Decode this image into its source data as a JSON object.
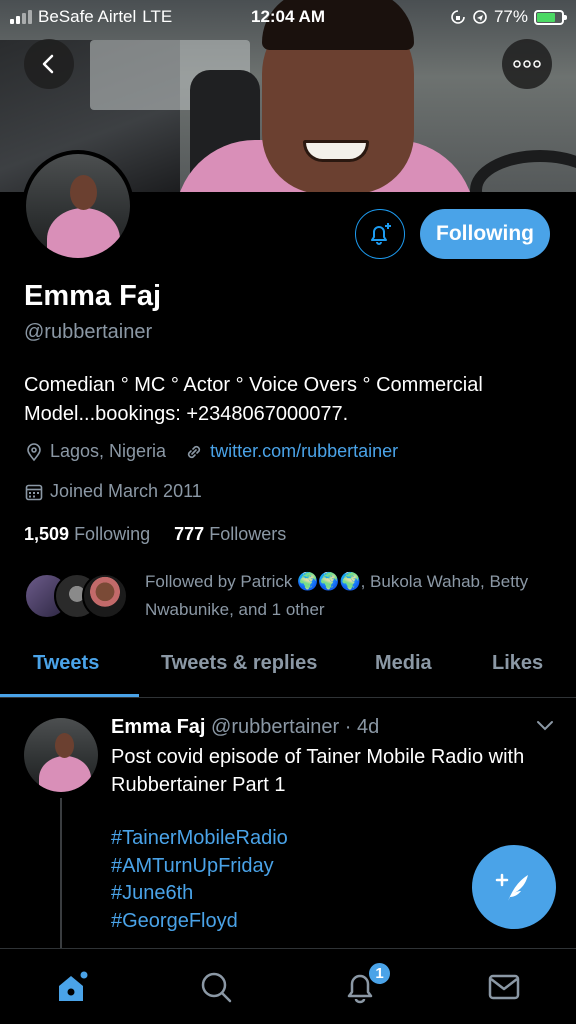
{
  "status_bar": {
    "carrier": "BeSafe Airtel",
    "network": "LTE",
    "time": "12:04 AM",
    "battery_percent": "77%",
    "battery_level": 0.77
  },
  "profile": {
    "name": "Emma Faj",
    "handle": "@rubbertainer",
    "bio": "Comedian ° MC ° Actor ° Voice Overs ° Commercial Model...bookings: +2348067000077.",
    "location": "Lagos, Nigeria",
    "website": "twitter.com/rubbertainer",
    "joined": "Joined March 2011",
    "following_count": "1,509",
    "following_label": "Following",
    "followers_count": "777",
    "followers_label": "Followers",
    "followed_by": "Followed by Patrick 🌍🌍🌍, Bukola Wahab, Betty Nwabunike, and 1 other",
    "follow_button_label": "Following"
  },
  "tabs": [
    {
      "label": "Tweets",
      "active": true
    },
    {
      "label": "Tweets & replies",
      "active": false
    },
    {
      "label": "Media",
      "active": false
    },
    {
      "label": "Likes",
      "active": false
    }
  ],
  "tweet": {
    "author": "Emma Faj",
    "handle": "@rubbertainer",
    "time": "· 4d",
    "text": "Post covid episode of Tainer Mobile Radio with Rubbertainer Part 1",
    "hashtags": [
      "#TainerMobileRadio",
      "#AMTurnUpFriday",
      "#June6th",
      "#GeorgeFloyd"
    ]
  },
  "bottom_nav": {
    "items": [
      "home-icon",
      "search-icon",
      "bell-icon",
      "mail-icon"
    ],
    "notification_badge": "1"
  },
  "colors": {
    "accent": "#4aa3e8",
    "background": "#000000",
    "secondary_text": "#8b98a5",
    "divider": "#2f3336"
  }
}
